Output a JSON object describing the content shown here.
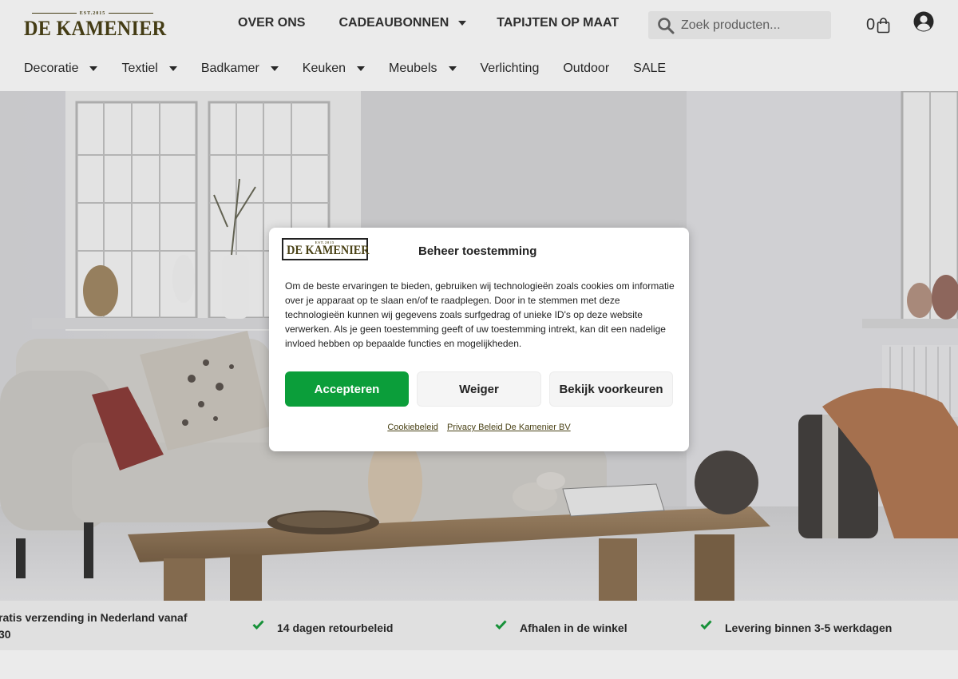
{
  "header": {
    "logo": {
      "est": "EST.2015",
      "name": "DE KAMENIER"
    },
    "topnav": [
      {
        "label": "OVER ONS",
        "has_dropdown": false
      },
      {
        "label": "CADEAUBONNEN",
        "has_dropdown": true
      },
      {
        "label": "TAPIJTEN OP MAAT",
        "has_dropdown": false
      }
    ],
    "search": {
      "placeholder": "Zoek producten...",
      "icon": "search-icon"
    },
    "cart": {
      "count": "0",
      "icon": "shopping-bag-icon"
    },
    "account": {
      "icon": "user-circle-icon"
    }
  },
  "catnav": [
    {
      "label": "Decoratie",
      "has_dropdown": true
    },
    {
      "label": "Textiel",
      "has_dropdown": true
    },
    {
      "label": "Badkamer",
      "has_dropdown": true
    },
    {
      "label": "Keuken",
      "has_dropdown": true
    },
    {
      "label": "Meubels",
      "has_dropdown": true
    },
    {
      "label": "Verlichting",
      "has_dropdown": false
    },
    {
      "label": "Outdoor",
      "has_dropdown": false
    },
    {
      "label": "SALE",
      "has_dropdown": false
    }
  ],
  "usp": [
    {
      "line1": "ratis verzending in Nederland vanaf",
      "line2": "30"
    },
    {
      "label": "14 dagen retourbeleid"
    },
    {
      "label": "Afhalen in de winkel"
    },
    {
      "label": "Levering binnen 3-5 werkdagen"
    }
  ],
  "consent": {
    "title": "Beheer toestemming",
    "logo": {
      "est": "EST.2015",
      "name": "DE KAMENIER"
    },
    "text": "Om de beste ervaringen te bieden, gebruiken wij technologieën zoals cookies om informatie over je apparaat op te slaan en/of te raadplegen. Door in te stemmen met deze technologieën kunnen wij gegevens zoals surfgedrag of unieke ID's op deze website verwerken. Als je geen toestemming geeft of uw toestemming intrekt, kan dit een nadelige invloed hebben op bepaalde functies en mogelijkheden.",
    "accept_label": "Accepteren",
    "deny_label": "Weiger",
    "preferences_label": "Bekijk voorkeuren",
    "links": [
      "Cookiebeleid",
      "Privacy Beleid De Kamenier BV"
    ]
  },
  "colors": {
    "accept_green": "#0b9e3a",
    "check_green": "#1a9e3e",
    "brand_olive": "#4a4216"
  }
}
